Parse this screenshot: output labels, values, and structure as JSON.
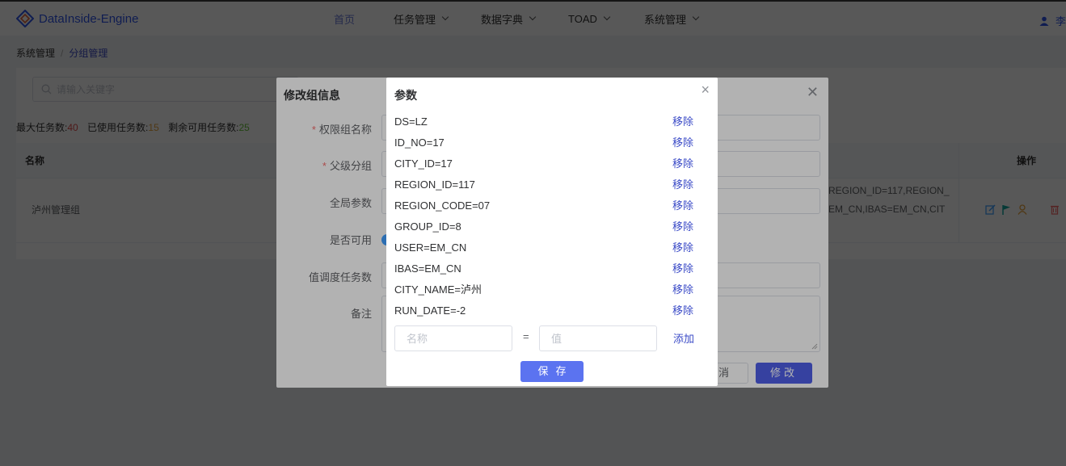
{
  "app": {
    "title": "DataInside-Engine",
    "brand_color": "#2f54eb",
    "logo_icon": "diamond-logo-icon"
  },
  "nav": {
    "items": [
      {
        "label": "首页"
      },
      {
        "label": "任务管理"
      },
      {
        "label": "数据字典"
      },
      {
        "label": "TOAD"
      },
      {
        "label": "系统管理"
      }
    ],
    "user_name": "李"
  },
  "breadcrumb": {
    "root": "系统管理",
    "separator": "/",
    "current": "分组管理"
  },
  "list": {
    "search_placeholder": "请输入关键字",
    "stats": {
      "max_label": "最大任务数:",
      "max_value": "40",
      "used_label": "已使用任务数:",
      "used_value": "15",
      "remain_label": "剩余可用任务数:",
      "remain_value": "25"
    },
    "columns": {
      "name": "名称",
      "actions": "操作"
    },
    "row": {
      "name": "泸州管理组",
      "params_line1": "REGION_ID=117,REGION_",
      "params_line2": "EM_CN,IBAS=EM_CN,CIT"
    }
  },
  "edit_dialog": {
    "title": "修改组信息",
    "fields": {
      "group_name": "权限组名称",
      "parent_group": "父级分组",
      "global_params": "全局参数",
      "enabled": "是否可用",
      "schedule_tasks": "值调度任务数",
      "remark": "备注"
    },
    "cancel_label": "消",
    "modify_label": "修改"
  },
  "param_dialog": {
    "title": "参数",
    "params": [
      {
        "text": "DS=LZ",
        "remove": "移除"
      },
      {
        "text": "ID_NO=17",
        "remove": "移除"
      },
      {
        "text": "CITY_ID=17",
        "remove": "移除"
      },
      {
        "text": "REGION_ID=117",
        "remove": "移除"
      },
      {
        "text": "REGION_CODE=07",
        "remove": "移除"
      },
      {
        "text": "GROUP_ID=8",
        "remove": "移除"
      },
      {
        "text": "USER=EM_CN",
        "remove": "移除"
      },
      {
        "text": "IBAS=EM_CN",
        "remove": "移除"
      },
      {
        "text": "CITY_NAME=泸州",
        "remove": "移除"
      },
      {
        "text": "RUN_DATE=-2",
        "remove": "移除"
      }
    ],
    "name_placeholder": "名称",
    "equals": "=",
    "value_placeholder": "值",
    "add_label": "添加",
    "save_label": "保存"
  }
}
